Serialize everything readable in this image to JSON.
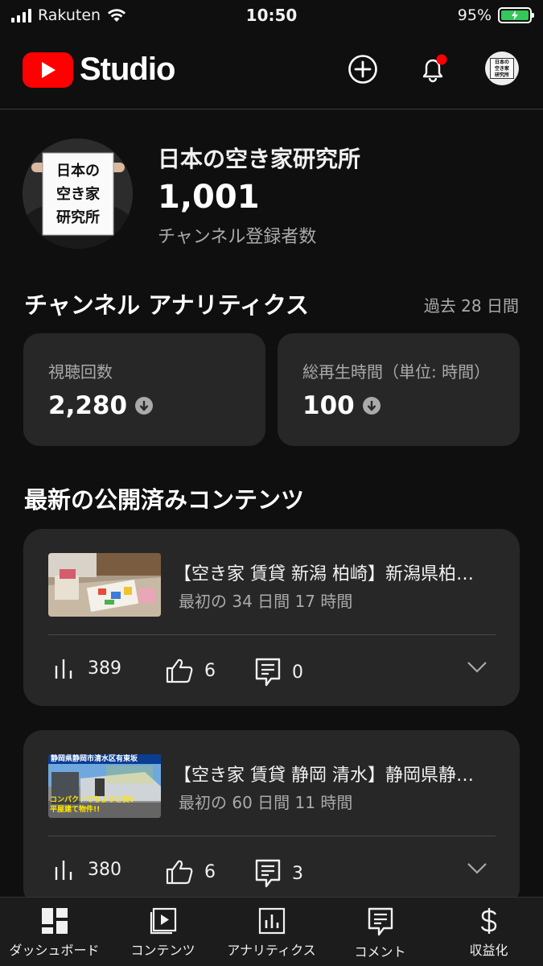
{
  "status_bar": {
    "carrier": "Rakuten",
    "time": "10:50",
    "battery": "95%"
  },
  "header": {
    "logo_text": "Studio",
    "avatar_text": "日本の空き家研究所"
  },
  "channel": {
    "name": "日本の空き家研究所",
    "subscriber_count": "1,001",
    "subscriber_label": "チャンネル登録者数",
    "avatar_lines": [
      "日本の",
      "空き家",
      "研究所"
    ]
  },
  "analytics": {
    "title": "チャンネル アナリティクス",
    "period": "過去 28 日間",
    "cards": [
      {
        "label": "視聴回数",
        "value": "2,280"
      },
      {
        "label": "総再生時間（単位: 時間）",
        "value": "100"
      }
    ]
  },
  "latest": {
    "title": "最新の公開済みコンテンツ",
    "videos": [
      {
        "title": "【空き家 賃貸 新潟 柏崎】新潟県柏…",
        "subtitle": "最初の 34 日間 17 時間",
        "views": "389",
        "likes": "6",
        "comments": "0"
      },
      {
        "title": "【空き家 賃貸 静岡 清水】静岡県静…",
        "subtitle": "最初の 60 日間 11 時間",
        "views": "380",
        "likes": "6",
        "comments": "3",
        "thumb_text": [
          "静岡県静岡市清水区有東坂",
          "コンパクトでちょうど良い",
          "平屋建て物件!!"
        ]
      }
    ]
  },
  "bottom_nav": [
    {
      "label": "ダッシュボード",
      "icon": "dashboard-icon"
    },
    {
      "label": "コンテンツ",
      "icon": "content-icon"
    },
    {
      "label": "アナリティクス",
      "icon": "analytics-icon"
    },
    {
      "label": "コメント",
      "icon": "comment-icon"
    },
    {
      "label": "収益化",
      "icon": "dollar-icon"
    }
  ],
  "colors": {
    "brand": "#ff0000",
    "background": "#0f0f0f",
    "card": "#272727",
    "battery": "#34c759",
    "muted": "#aaaaaa"
  }
}
